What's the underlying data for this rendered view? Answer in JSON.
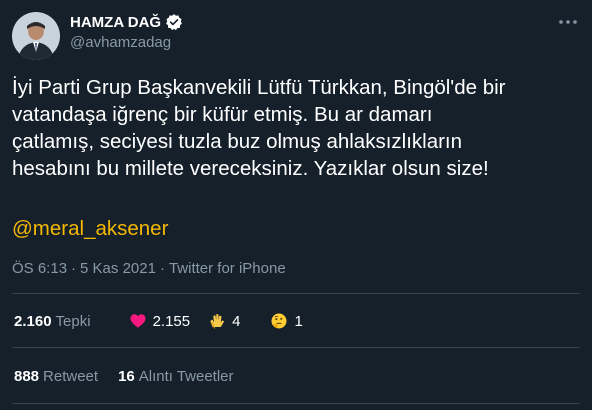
{
  "author": {
    "display_name": "HAMZA DAĞ",
    "handle": "@avhamzadag",
    "verified": true
  },
  "tweet": {
    "text": "İyi Parti Grup Başkanvekili Lütfü Türkkan, Bingöl'de bir\nvatandaşa iğrenç bir küfür etmiş. Bu ar damarı\nçatlamış, seciyesi tuzla buz olmuş ahlaksızlıkların\nhesabını bu millete vereceksiniz. Yazıklar olsun size!",
    "mention": "@meral_aksener"
  },
  "meta": {
    "time": "ÖS 6:13",
    "separator1": "·",
    "date": "5 Kas 2021",
    "separator2": "·",
    "source": "Twitter for iPhone"
  },
  "reactions": {
    "total_count": "2.160",
    "total_label": "Tepki",
    "heart_count": "2.155",
    "clap_count": "4",
    "thinking_count": "1"
  },
  "retweets": {
    "retweet_count": "888",
    "retweet_label": "Retweet",
    "quote_count": "16",
    "quote_label": "Alıntı Tweetler"
  },
  "icons": {
    "more": "more-icon",
    "verified": "verified-badge-icon",
    "heart": "heart-emoji",
    "clap": "clap-emoji",
    "thinking": "thinking-emoji"
  },
  "colors": {
    "background": "#15202b",
    "text": "#ffffff",
    "muted": "#8899a6",
    "mention": "#f5b800",
    "verified": "#1d9bf0",
    "heart": "#f91880",
    "divider": "#38444d"
  }
}
